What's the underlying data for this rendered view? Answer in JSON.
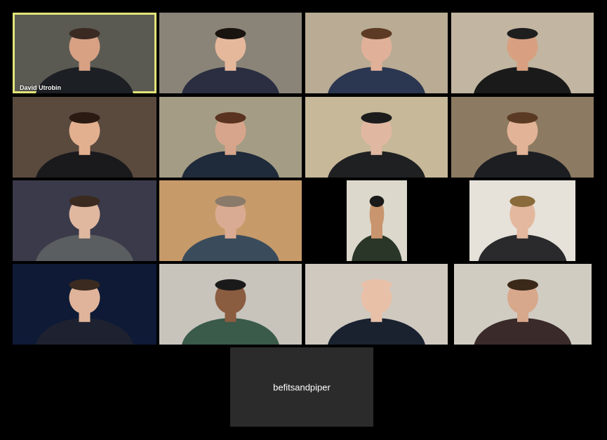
{
  "meeting": {
    "participants": [
      {
        "id": "p1",
        "name": "David Utrobin",
        "active": true,
        "bg": "#5a5a52",
        "shirt": "#1c1f24",
        "skin": "#d8a184",
        "hair": "#3a2a22"
      },
      {
        "id": "p2",
        "name": "",
        "bg": "#8a8478",
        "shirt": "#2a2e40",
        "skin": "#e5b89c",
        "hair": "#1a1410"
      },
      {
        "id": "p3",
        "name": "",
        "bg": "#b9ab94",
        "shirt": "#2b3650",
        "skin": "#e0b098",
        "hair": "#5c3a24"
      },
      {
        "id": "p4",
        "name": "",
        "bg": "#c2b5a1",
        "shirt": "#1a1a1a",
        "skin": "#d8a080",
        "hair": "#1e1e1e"
      },
      {
        "id": "p5",
        "name": "",
        "bg": "#5a4a3e",
        "shirt": "#1a1a1d",
        "skin": "#e3b08f",
        "hair": "#2a1a12"
      },
      {
        "id": "p6",
        "name": "",
        "bg": "#a49c84",
        "shirt": "#1f2a3a",
        "skin": "#d7a58b",
        "hair": "#5a3220"
      },
      {
        "id": "p7",
        "name": "",
        "bg": "#c6b898",
        "shirt": "#1f2022",
        "skin": "#e0b8a2",
        "hair": "#1c1c1c"
      },
      {
        "id": "p8",
        "name": "",
        "bg": "#8c7a62",
        "shirt": "#1c1e22",
        "skin": "#e2b396",
        "hair": "#5a3a22"
      },
      {
        "id": "p9",
        "name": "",
        "bg": "#3a3a4a",
        "shirt": "#5a5e60",
        "skin": "#e0b8a0",
        "hair": "#3a2a20"
      },
      {
        "id": "p10",
        "name": "",
        "bg": "#c79a6a",
        "shirt": "#3a4c5c",
        "skin": "#d9ab92",
        "hair": "#8a7a6a"
      },
      {
        "id": "p11",
        "name": "",
        "bg": "#dcd8cc",
        "shirt": "#2a3628",
        "skin": "#c9956e",
        "hair": "#1a1a1a"
      },
      {
        "id": "p12",
        "name": "",
        "bg": "#e6e2da",
        "shirt": "#2a2a2c",
        "skin": "#e3b89e",
        "hair": "#8a6a3a"
      },
      {
        "id": "p13",
        "name": "",
        "bg": "#0e1a36",
        "shirt": "#1e2230",
        "skin": "#e0b49a",
        "hair": "#3a2a20"
      },
      {
        "id": "p14",
        "name": "",
        "bg": "#c8c4bc",
        "shirt": "#3a5a4a",
        "skin": "#8a5c40",
        "hair": "#1a1a1a"
      },
      {
        "id": "p15",
        "name": "",
        "bg": "#cfc9c0",
        "shirt": "#1a2230",
        "skin": "#e8c0a8",
        "hair": "#e8c0a8"
      },
      {
        "id": "p16",
        "name": "",
        "bg": "#d0ccc2",
        "shirt": "#3a2a2a",
        "skin": "#d8a88c",
        "hair": "#3a2818"
      }
    ],
    "audio_only": {
      "name": "befitsandpiper"
    }
  }
}
